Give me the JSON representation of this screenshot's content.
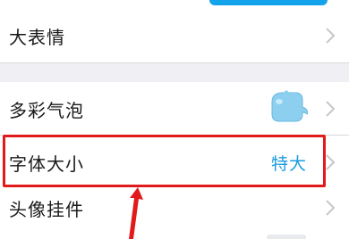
{
  "settings": {
    "items": [
      {
        "label": "大表情"
      },
      {
        "label": "多彩气泡"
      },
      {
        "label": "字体大小",
        "value": "特大"
      },
      {
        "label": "头像挂件"
      }
    ]
  },
  "colors": {
    "accent": "#1d9be0",
    "highlight": "#e11b1b",
    "background": "#f0eff4"
  }
}
